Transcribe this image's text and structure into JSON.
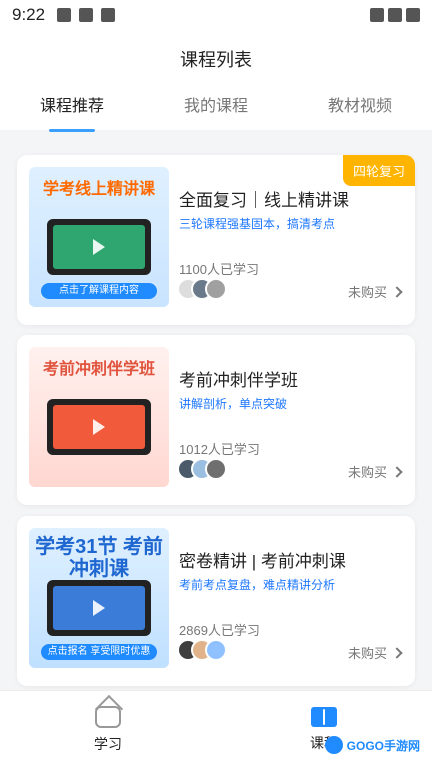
{
  "statusbar": {
    "time": "9:22"
  },
  "header": {
    "title": "课程列表"
  },
  "tabs": [
    {
      "label": "课程推荐",
      "active": true
    },
    {
      "label": "我的课程",
      "active": false
    },
    {
      "label": "教材视频",
      "active": false
    }
  ],
  "courses": [
    {
      "thumb_title": "学考线上精讲课",
      "thumb_cta": "点击了解课程内容",
      "title": "全面复习｜线上精讲课",
      "subtitle": "三轮课程强基固本，搞清考点",
      "learners": "1100人已学习",
      "status": "未购买",
      "badge": "四轮复习"
    },
    {
      "thumb_title": "考前冲刺伴学班",
      "thumb_cta": "",
      "title": "考前冲刺伴学班",
      "subtitle": "讲解剖析，单点突破",
      "learners": "1012人已学习",
      "status": "未购买"
    },
    {
      "thumb_title": "学考31节 考前冲刺课",
      "thumb_cta": "点击报名 享受限时优惠",
      "title": "密卷精讲 | 考前冲刺课",
      "subtitle": "考前考点复盘，难点精讲分析",
      "learners": "2869人已学习",
      "status": "未购买"
    }
  ],
  "bottomnav": [
    {
      "label": "学习",
      "active": false
    },
    {
      "label": "课程",
      "active": true
    }
  ],
  "watermark": {
    "text": "GOGO手游网"
  },
  "colors": {
    "accent": "#1f8bff",
    "badge": "#ffb400",
    "subtitle": "#1f78ff"
  }
}
